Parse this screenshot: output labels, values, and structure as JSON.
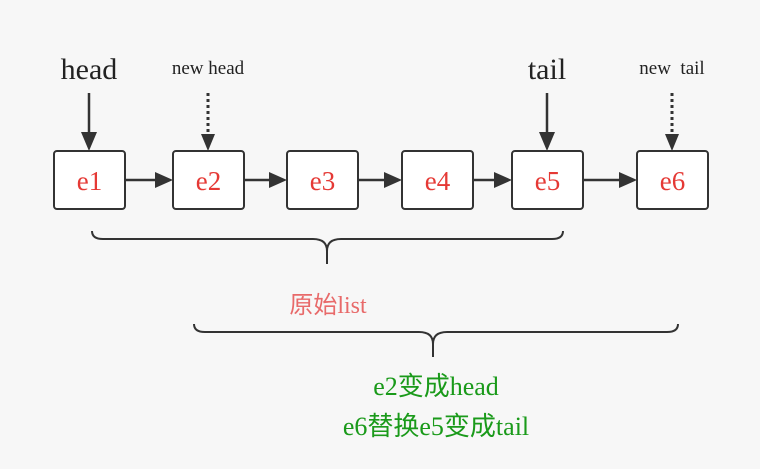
{
  "nodes": [
    "e1",
    "e2",
    "e3",
    "e4",
    "e5",
    "e6"
  ],
  "pointers": {
    "head": "head",
    "new_head": "new head",
    "tail": "tail",
    "new_tail": "new  tail"
  },
  "captions": {
    "original": "原始list",
    "new_line1": "e2变成head",
    "new_line2": "e6替换e5变成tail"
  },
  "colors": {
    "node_text": "#e53935",
    "original_caption": "#e86a6a",
    "new_caption": "#1a9a1a"
  }
}
